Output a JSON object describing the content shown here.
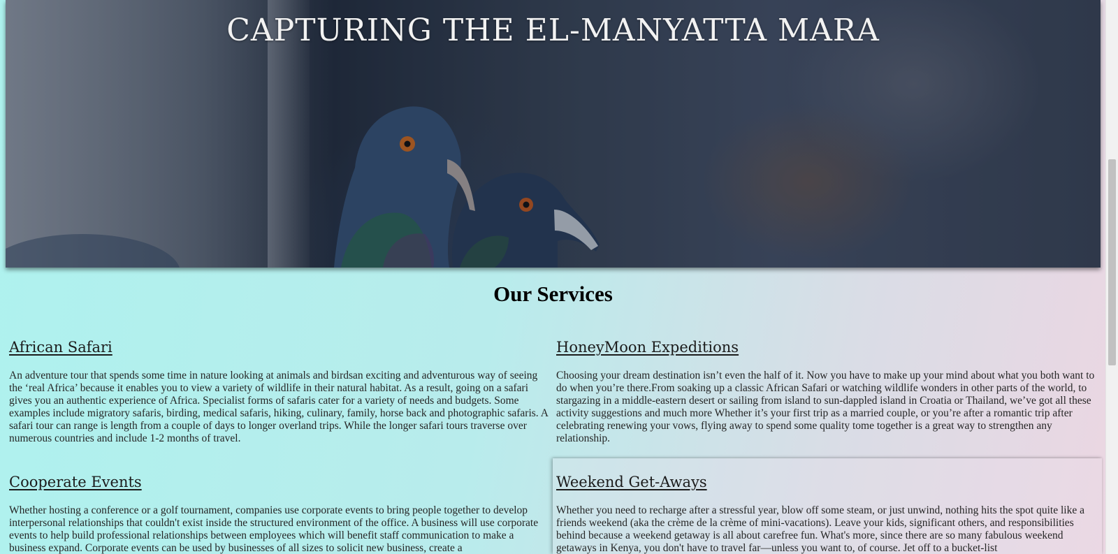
{
  "hero": {
    "title": "CAPTURING THE EL-MANYATTA MARA",
    "image_alt": "pigeons"
  },
  "services": {
    "heading": "Our Services",
    "items": [
      {
        "title": "African Safari",
        "text": "An adventure tour that spends some time in nature looking at animals and birdsan exciting and adventurous way of seeing the ‘real Africa’ because it enables you to view a variety of wildlife in their natural habitat. As a result, going on a safari gives you an authentic experience of Africa. Specialist forms of safaris cater for a variety of needs and budgets. Some examples include migratory safaris, birding, medical safaris, hiking, culinary, family, horse back and photographic safaris. A safari tour can range is length from a couple of days to longer overland trips. While the longer safari tours traverse over numerous countries and include 1-2 months of travel."
      },
      {
        "title": "HoneyMoon Expeditions",
        "text": "Choosing your dream destination isn’t even the half of it. Now you have to make up your mind about what you both want to do when you’re there.From soaking up a classic African Safari or watching wildlife wonders in other parts of the world, to stargazing in a middle-eastern desert or sailing from island to sun-dappled island in Croatia or Thailand, we’ve got all these activity suggestions and much more Whether it’s your first trip as a married couple, or you’re after a romantic trip after celebrating renewing your vows, flying away to spend some quality tome together is a great way to strengthen any relationship."
      },
      {
        "title": "Cooperate Events",
        "text": "Whether hosting a conference or a golf tournament, companies use corporate events to bring people together to develop interpersonal relationships that couldn't exist inside the structured environment of the office. A business will use corporate events to help build professional relationships between employees which will benefit staff communication to make a business expand. Corporate events can be used by businesses of all sizes to solicit new business, create a"
      },
      {
        "title": "Weekend Get-Aways",
        "text": "Whether you need to recharge after a stressful year, blow off some steam, or just unwind, nothing hits the spot quite like a friends weekend (aka the crème de la crème of mini-vacations). Leave your kids, significant others, and responsibilities behind because a weekend getaway is all about carefree fun. What's more, since there are so many fabulous weekend getaways in Kenya, you don't have to travel far—unless you want to, of course. Jet off to a bucket-list"
      }
    ]
  }
}
